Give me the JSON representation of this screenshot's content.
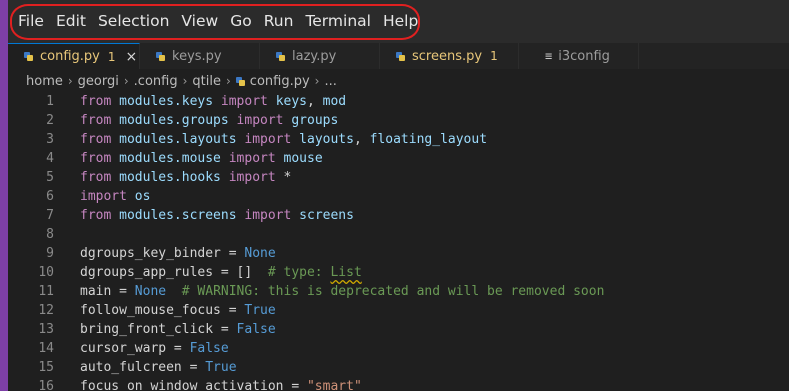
{
  "menubar": {
    "items": [
      "File",
      "Edit",
      "Selection",
      "View",
      "Go",
      "Run",
      "Terminal",
      "Help"
    ]
  },
  "tabs": [
    {
      "label": "config.py",
      "badge": "1",
      "close": "×",
      "icon": "python-icon",
      "active": true
    },
    {
      "label": "keys.py",
      "badge": "",
      "close": "",
      "icon": "python-icon",
      "active": false
    },
    {
      "label": "lazy.py",
      "badge": "",
      "close": "",
      "icon": "python-icon",
      "active": false
    },
    {
      "label": "screens.py",
      "badge": "1",
      "close": "",
      "icon": "python-icon",
      "active": false
    },
    {
      "label": "i3config",
      "badge": "",
      "close": "",
      "icon": "text-file-icon",
      "active": false
    }
  ],
  "breadcrumb": {
    "parts": [
      "home",
      "georgi",
      ".config",
      "qtile",
      "config.py",
      "..."
    ]
  },
  "editor": {
    "lines": [
      {
        "n": "1",
        "tokens": [
          [
            "kw",
            "from "
          ],
          [
            "mod",
            "modules.keys"
          ],
          [
            "kw",
            " import "
          ],
          [
            "mod",
            "keys"
          ],
          [
            "ident",
            ", "
          ],
          [
            "mod",
            "mod"
          ]
        ]
      },
      {
        "n": "2",
        "tokens": [
          [
            "kw",
            "from "
          ],
          [
            "mod",
            "modules.groups"
          ],
          [
            "kw",
            " import "
          ],
          [
            "mod",
            "groups"
          ]
        ]
      },
      {
        "n": "3",
        "tokens": [
          [
            "kw",
            "from "
          ],
          [
            "mod",
            "modules.layouts"
          ],
          [
            "kw",
            " import "
          ],
          [
            "mod",
            "layouts"
          ],
          [
            "ident",
            ", "
          ],
          [
            "mod",
            "floating_layout"
          ]
        ]
      },
      {
        "n": "4",
        "tokens": [
          [
            "kw",
            "from "
          ],
          [
            "mod",
            "modules.mouse"
          ],
          [
            "kw",
            " import "
          ],
          [
            "mod",
            "mouse"
          ]
        ]
      },
      {
        "n": "5",
        "tokens": [
          [
            "kw",
            "from "
          ],
          [
            "mod",
            "modules.hooks"
          ],
          [
            "kw",
            " import "
          ],
          [
            "ident",
            "*"
          ]
        ]
      },
      {
        "n": "6",
        "tokens": [
          [
            "kw",
            "import "
          ],
          [
            "mod",
            "os"
          ]
        ]
      },
      {
        "n": "7",
        "tokens": [
          [
            "kw",
            "from "
          ],
          [
            "mod",
            "modules.screens"
          ],
          [
            "kw",
            " import "
          ],
          [
            "mod",
            "screens"
          ]
        ]
      },
      {
        "n": "8",
        "tokens": []
      },
      {
        "n": "9",
        "tokens": [
          [
            "ident",
            "dgroups_key_binder = "
          ],
          [
            "const",
            "None"
          ]
        ]
      },
      {
        "n": "10",
        "tokens": [
          [
            "ident",
            "dgroups_app_rules = []  "
          ],
          [
            "cmt",
            "# type: "
          ],
          [
            "cmtsq",
            "List"
          ]
        ]
      },
      {
        "n": "11",
        "tokens": [
          [
            "ident",
            "main = "
          ],
          [
            "const",
            "None"
          ],
          [
            "cmt",
            "  # WARNING: this is deprecated and will be removed soon"
          ]
        ]
      },
      {
        "n": "12",
        "tokens": [
          [
            "ident",
            "follow_mouse_focus = "
          ],
          [
            "const",
            "True"
          ]
        ]
      },
      {
        "n": "13",
        "tokens": [
          [
            "ident",
            "bring_front_click = "
          ],
          [
            "const",
            "False"
          ]
        ]
      },
      {
        "n": "14",
        "tokens": [
          [
            "ident",
            "cursor_warp = "
          ],
          [
            "const",
            "False"
          ]
        ]
      },
      {
        "n": "15",
        "tokens": [
          [
            "ident",
            "auto_fulcreen = "
          ],
          [
            "const",
            "True"
          ]
        ]
      },
      {
        "n": "16",
        "tokens": [
          [
            "ident",
            "focus_on_window_activation = "
          ],
          [
            "str",
            "\"smart\""
          ]
        ]
      }
    ]
  }
}
